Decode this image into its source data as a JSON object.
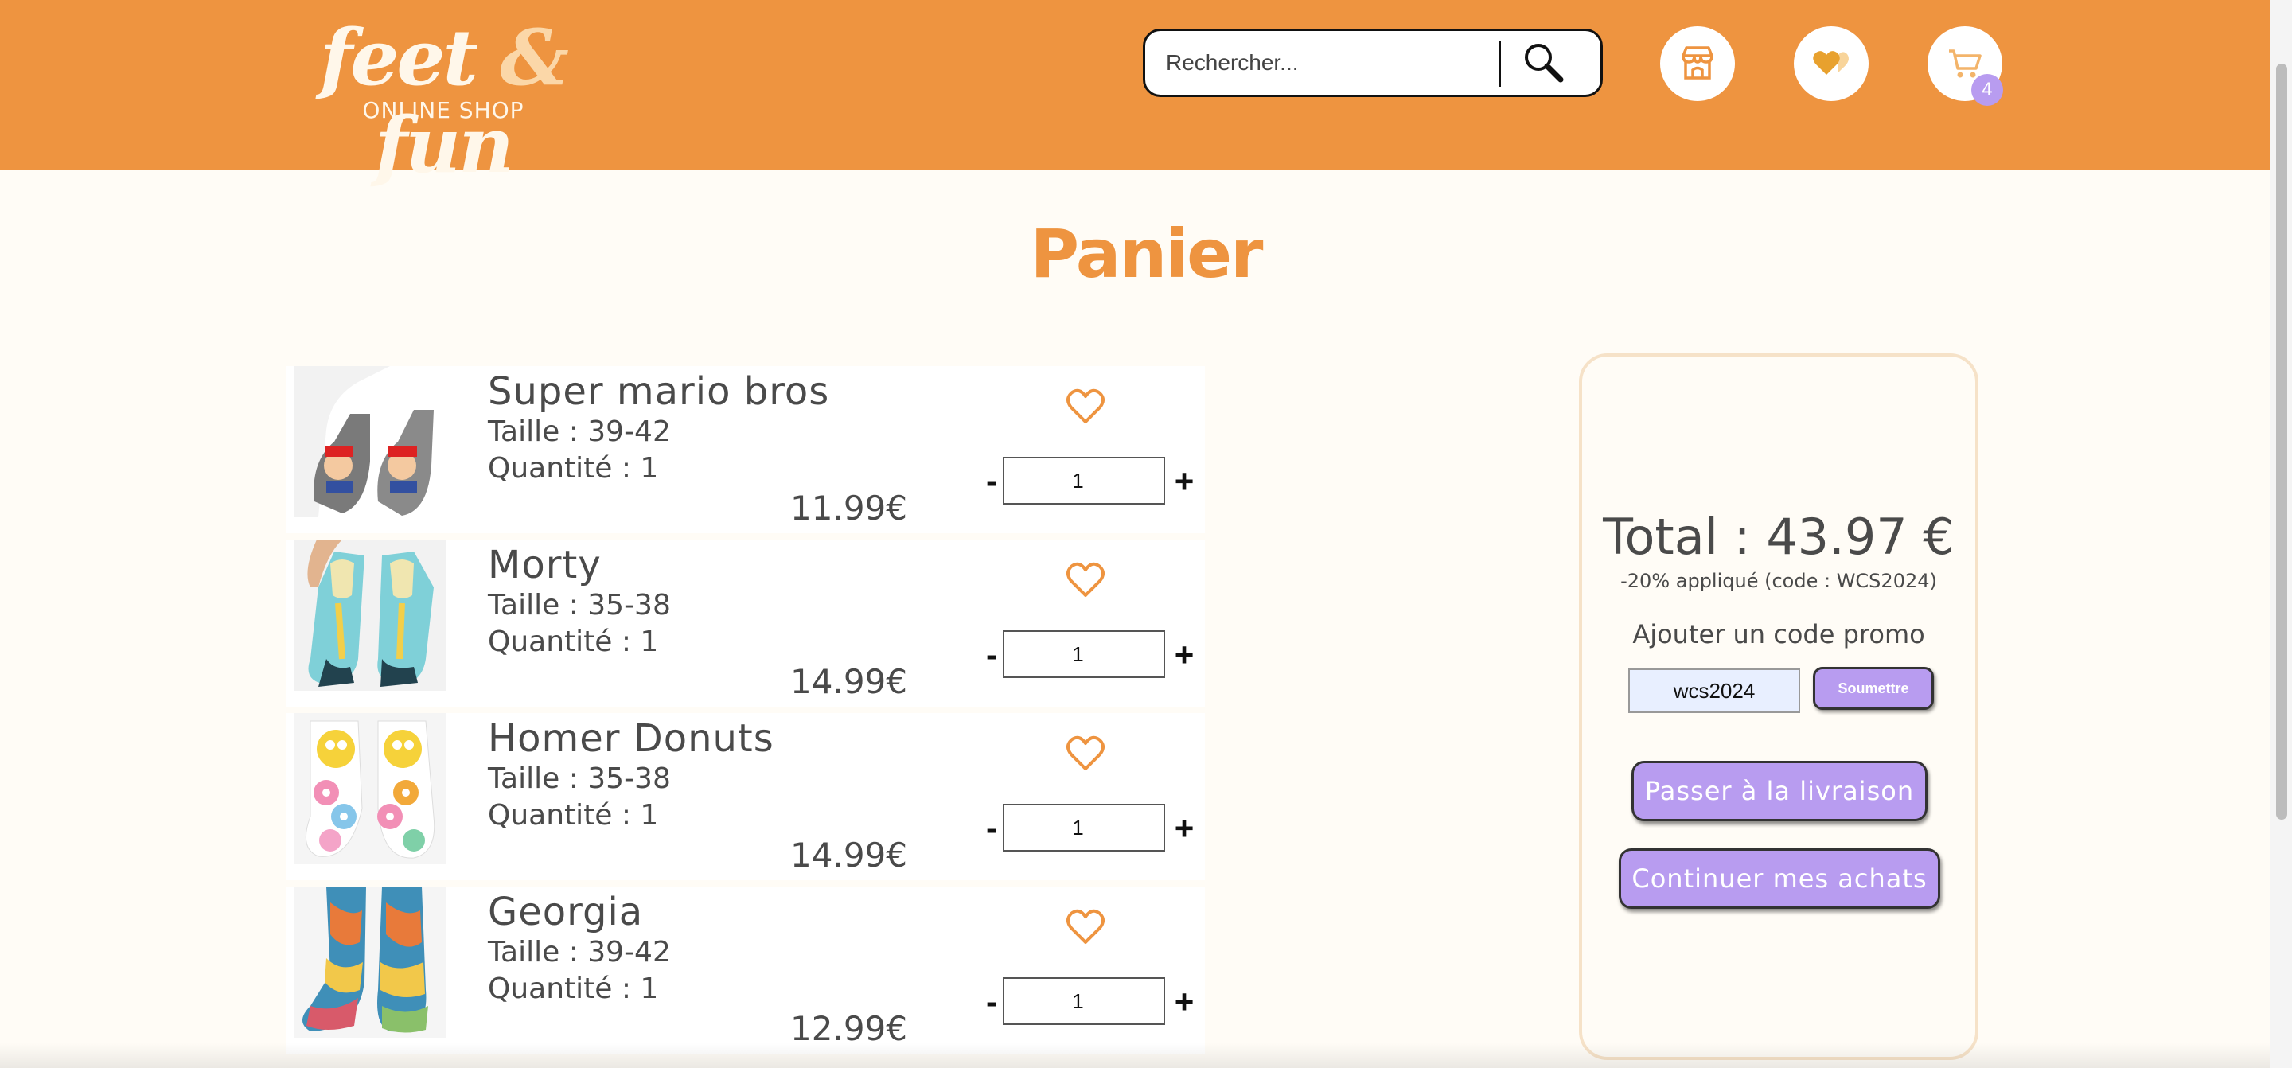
{
  "header": {
    "logo_text_left": "feet",
    "logo_ampersand": "&",
    "logo_text_right": "fun",
    "logo_subtitle": "ONLINE SHOP",
    "search_placeholder": "Rechercher...",
    "cart_count": "4",
    "icons": [
      "search-icon",
      "shop-icon",
      "heart-icon",
      "cart-icon"
    ]
  },
  "page": {
    "title": "Panier"
  },
  "cart": {
    "items": [
      {
        "name": "Super mario bros",
        "size": "Taille : 39-42",
        "quantity_text": "Quantité : 1",
        "price": "11.99€",
        "qty": "1"
      },
      {
        "name": "Morty",
        "size": "Taille : 35-38",
        "quantity_text": "Quantité : 1",
        "price": "14.99€",
        "qty": "1"
      },
      {
        "name": "Homer Donuts",
        "size": "Taille : 35-38",
        "quantity_text": "Quantité : 1",
        "price": "14.99€",
        "qty": "1"
      },
      {
        "name": "Georgia",
        "size": "Taille : 39-42",
        "quantity_text": "Quantité : 1",
        "price": "12.99€",
        "qty": "1"
      }
    ],
    "minus_label": "-",
    "plus_label": "+"
  },
  "summary": {
    "total": "Total : 43.97 €",
    "discount": "-20% appliqué (code : WCS2024)",
    "promo_label": "Ajouter un code promo",
    "promo_value": "wcs2024",
    "submit_label": "Soumettre",
    "delivery_label": "Passer à la livraison",
    "continue_label": "Continuer mes achats"
  },
  "colors": {
    "header_bg": "#ee9440",
    "page_bg": "#fffcf6",
    "accent_orange": "#ee9440",
    "button_purple": "#b89cf0",
    "summary_border": "#f6e2c8"
  }
}
